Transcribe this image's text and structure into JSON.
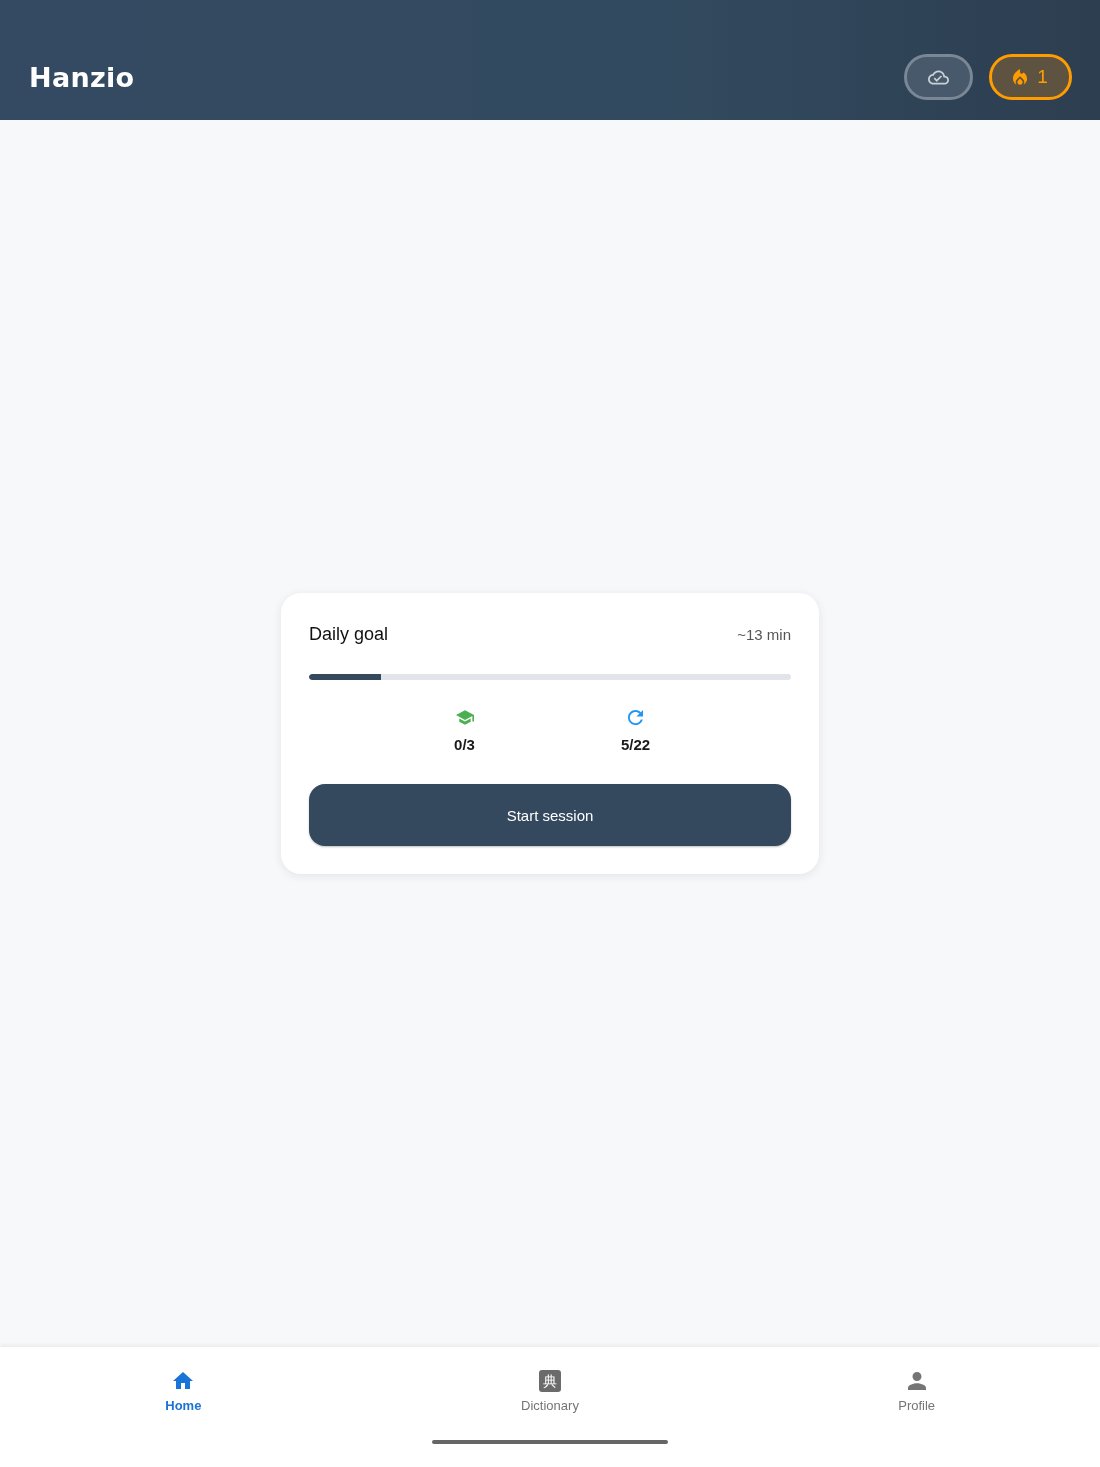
{
  "app_bar": {
    "title": "Hanzio",
    "actions": [
      {
        "kind": "sync"
      },
      {
        "kind": "streak",
        "label": "1"
      }
    ]
  },
  "daily_goal": {
    "title": "Daily goal",
    "estimate": "~13 min",
    "progress": {
      "level": 0.15
    },
    "stats": [
      {
        "kind": "new",
        "value": "0/3"
      },
      {
        "kind": "review",
        "value": "5/22"
      }
    ],
    "button": "Start session"
  },
  "bottom_nav": [
    {
      "kind": "home",
      "label": "Home",
      "selected": true
    },
    {
      "kind": "dictionary",
      "icon_glyph": "典",
      "label": "Dictionary",
      "selected": false
    },
    {
      "kind": "profile",
      "label": "Profile",
      "selected": false
    }
  ]
}
